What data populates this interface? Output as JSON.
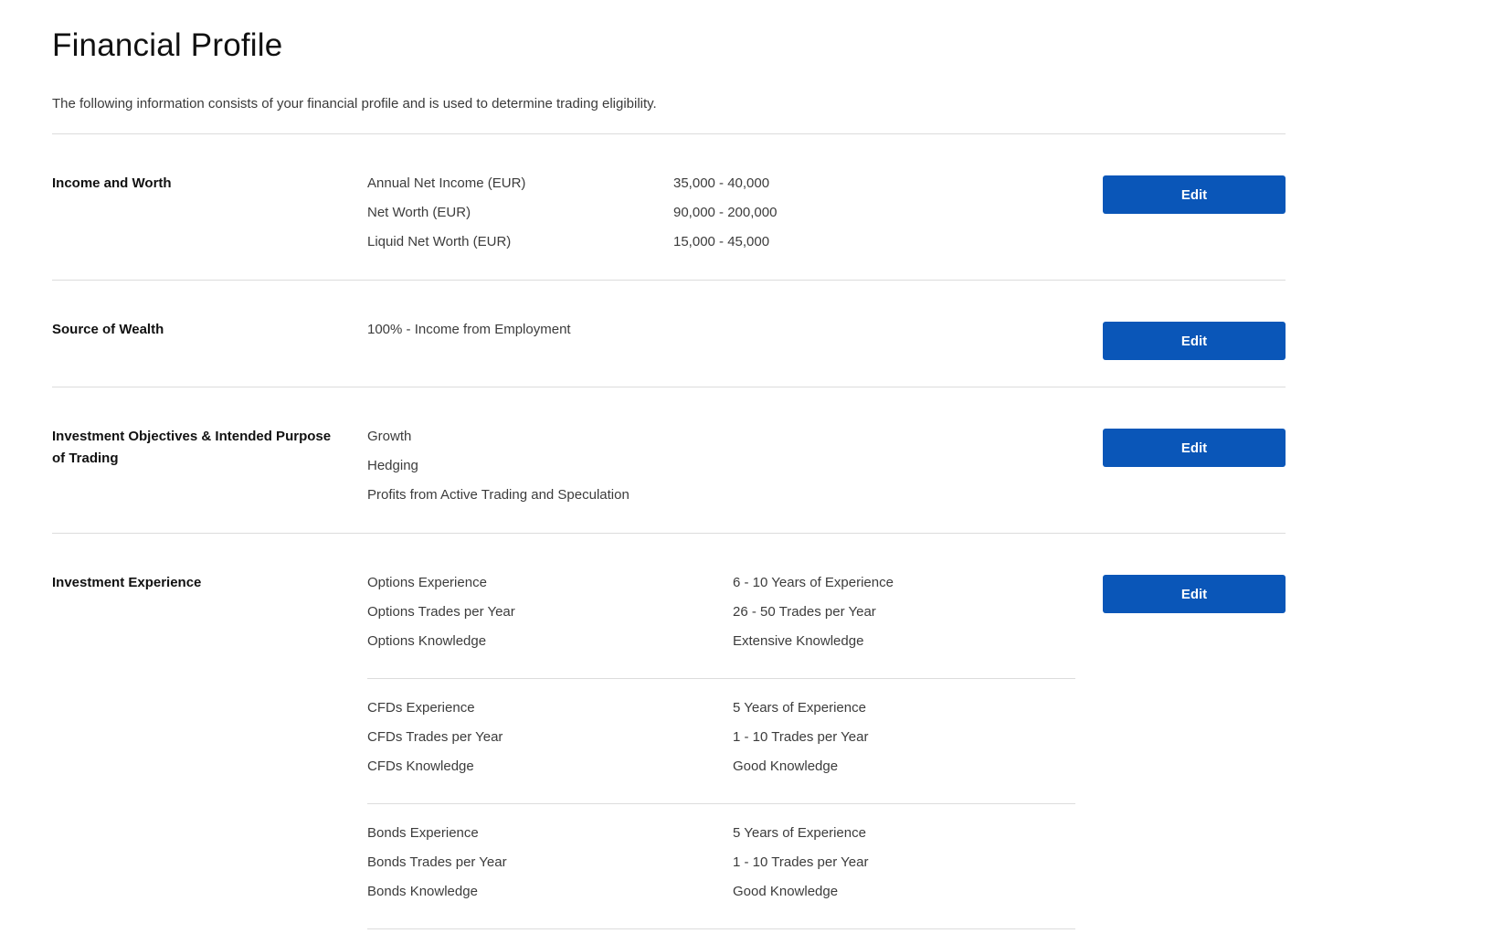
{
  "page": {
    "title": "Financial Profile",
    "intro": "The following information consists of your financial profile and is used to determine trading eligibility."
  },
  "colors": {
    "button_bg": "#0a56b8",
    "divider": "#dcdcdc"
  },
  "sections": {
    "income": {
      "title": "Income and Worth",
      "edit_label": "Edit",
      "rows": [
        {
          "label": "Annual Net Income (EUR)",
          "value": "35,000 - 40,000"
        },
        {
          "label": "Net Worth (EUR)",
          "value": "90,000 - 200,000"
        },
        {
          "label": "Liquid Net Worth (EUR)",
          "value": "15,000 - 45,000"
        }
      ]
    },
    "wealth": {
      "title": "Source of Wealth",
      "edit_label": "Edit",
      "items": [
        "100% - Income from Employment"
      ]
    },
    "objectives": {
      "title": "Investment Objectives & Intended Purpose of Trading",
      "edit_label": "Edit",
      "items": [
        "Growth",
        "Hedging",
        "Profits from Active Trading and Speculation"
      ]
    },
    "experience": {
      "title": "Investment Experience",
      "edit_label": "Edit",
      "groups": [
        {
          "rows": [
            {
              "label": "Options Experience",
              "value": "6 - 10 Years of Experience"
            },
            {
              "label": "Options Trades per Year",
              "value": "26 - 50 Trades per Year"
            },
            {
              "label": "Options Knowledge",
              "value": "Extensive Knowledge"
            }
          ]
        },
        {
          "rows": [
            {
              "label": "CFDs Experience",
              "value": "5 Years of Experience"
            },
            {
              "label": "CFDs Trades per Year",
              "value": "1 - 10 Trades per Year"
            },
            {
              "label": "CFDs Knowledge",
              "value": "Good Knowledge"
            }
          ]
        },
        {
          "rows": [
            {
              "label": "Bonds Experience",
              "value": "5 Years of Experience"
            },
            {
              "label": "Bonds Trades per Year",
              "value": "1 - 10 Trades per Year"
            },
            {
              "label": "Bonds Knowledge",
              "value": "Good Knowledge"
            }
          ]
        }
      ]
    }
  }
}
